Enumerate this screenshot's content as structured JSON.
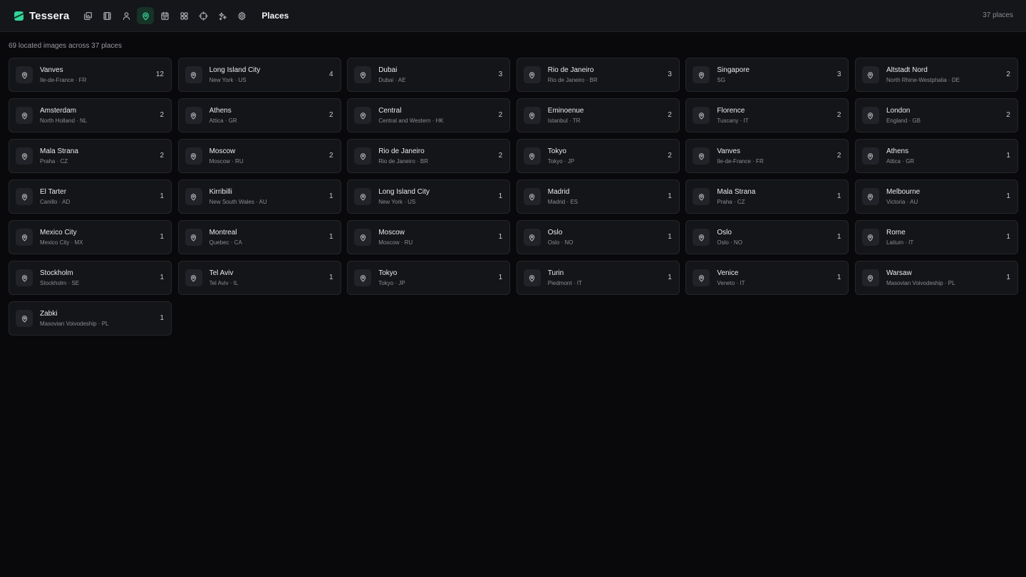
{
  "app": {
    "name": "Tessera",
    "page_title": "Places",
    "top_count": "37 places"
  },
  "nav": [
    {
      "icon": "photos-icon",
      "active": false
    },
    {
      "icon": "film-icon",
      "active": false
    },
    {
      "icon": "person-icon",
      "active": false
    },
    {
      "icon": "map-pin-icon",
      "active": true
    },
    {
      "icon": "calendar-icon",
      "active": false
    },
    {
      "icon": "grid-icon",
      "active": false
    },
    {
      "icon": "crosshair-icon",
      "active": false
    },
    {
      "icon": "sparkles-icon",
      "active": false
    },
    {
      "icon": "gear-icon",
      "active": false
    }
  ],
  "summary": "69 located images across 37 places",
  "places": [
    {
      "name": "Vanves",
      "region": "Ile-de-France · FR",
      "count": "12"
    },
    {
      "name": "Long Island City",
      "region": "New York · US",
      "count": "4"
    },
    {
      "name": "Dubai",
      "region": "Dubai · AE",
      "count": "3"
    },
    {
      "name": "Rio de Janeiro",
      "region": "Rio de Janeiro · BR",
      "count": "3"
    },
    {
      "name": "Singapore",
      "region": "SG",
      "count": "3"
    },
    {
      "name": "Altstadt Nord",
      "region": "North Rhine-Westphalia · DE",
      "count": "2"
    },
    {
      "name": "Amsterdam",
      "region": "North Holland · NL",
      "count": "2"
    },
    {
      "name": "Athens",
      "region": "Attica · GR",
      "count": "2"
    },
    {
      "name": "Central",
      "region": "Central and Western · HK",
      "count": "2"
    },
    {
      "name": "Eminoenue",
      "region": "Istanbul · TR",
      "count": "2"
    },
    {
      "name": "Florence",
      "region": "Tuscany · IT",
      "count": "2"
    },
    {
      "name": "London",
      "region": "England · GB",
      "count": "2"
    },
    {
      "name": "Mala Strana",
      "region": "Praha · CZ",
      "count": "2"
    },
    {
      "name": "Moscow",
      "region": "Moscow · RU",
      "count": "2"
    },
    {
      "name": "Rio de Janeiro",
      "region": "Rio de Janeiro · BR",
      "count": "2"
    },
    {
      "name": "Tokyo",
      "region": "Tokyo · JP",
      "count": "2"
    },
    {
      "name": "Vanves",
      "region": "Ile-de-France · FR",
      "count": "2"
    },
    {
      "name": "Athens",
      "region": "Attica · GR",
      "count": "1"
    },
    {
      "name": "El Tarter",
      "region": "Canillo · AD",
      "count": "1"
    },
    {
      "name": "Kirribilli",
      "region": "New South Wales · AU",
      "count": "1"
    },
    {
      "name": "Long Island City",
      "region": "New York · US",
      "count": "1"
    },
    {
      "name": "Madrid",
      "region": "Madrid · ES",
      "count": "1"
    },
    {
      "name": "Mala Strana",
      "region": "Praha · CZ",
      "count": "1"
    },
    {
      "name": "Melbourne",
      "region": "Victoria · AU",
      "count": "1"
    },
    {
      "name": "Mexico City",
      "region": "Mexico City · MX",
      "count": "1"
    },
    {
      "name": "Montreal",
      "region": "Quebec · CA",
      "count": "1"
    },
    {
      "name": "Moscow",
      "region": "Moscow · RU",
      "count": "1"
    },
    {
      "name": "Oslo",
      "region": "Oslo · NO",
      "count": "1"
    },
    {
      "name": "Oslo",
      "region": "Oslo · NO",
      "count": "1"
    },
    {
      "name": "Rome",
      "region": "Latium · IT",
      "count": "1"
    },
    {
      "name": "Stockholm",
      "region": "Stockholm · SE",
      "count": "1"
    },
    {
      "name": "Tel Aviv",
      "region": "Tel Aviv · IL",
      "count": "1"
    },
    {
      "name": "Tokyo",
      "region": "Tokyo · JP",
      "count": "1"
    },
    {
      "name": "Turin",
      "region": "Piedmont · IT",
      "count": "1"
    },
    {
      "name": "Venice",
      "region": "Veneto · IT",
      "count": "1"
    },
    {
      "name": "Warsaw",
      "region": "Masovian Voivodeship · PL",
      "count": "1"
    },
    {
      "name": "Zabki",
      "region": "Masovian Voivodeship · PL",
      "count": "1"
    }
  ],
  "colors": {
    "accent": "#34d399",
    "background": "#09090b",
    "card": "#141518"
  }
}
